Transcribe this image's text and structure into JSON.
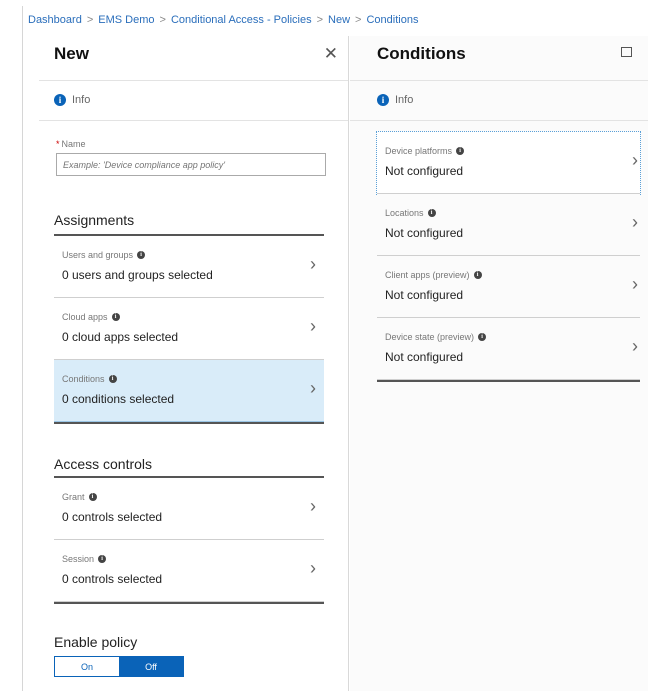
{
  "breadcrumb": [
    "Dashboard",
    "EMS Demo",
    "Conditional Access - Policies",
    "New",
    "Conditions"
  ],
  "left": {
    "title": "New",
    "info": "Info",
    "name_label": "Name",
    "name_placeholder": "Example: 'Device compliance app policy'",
    "assignments_title": "Assignments",
    "assignments": [
      {
        "label": "Users and groups",
        "value": "0 users and groups selected"
      },
      {
        "label": "Cloud apps",
        "value": "0 cloud apps selected"
      },
      {
        "label": "Conditions",
        "value": "0 conditions selected"
      }
    ],
    "access_title": "Access controls",
    "access": [
      {
        "label": "Grant",
        "value": "0 controls selected"
      },
      {
        "label": "Session",
        "value": "0 controls selected"
      }
    ],
    "enable_title": "Enable policy",
    "toggle_on": "On",
    "toggle_off": "Off"
  },
  "right": {
    "title": "Conditions",
    "info": "Info",
    "items": [
      {
        "label": "Device platforms",
        "value": "Not configured"
      },
      {
        "label": "Locations",
        "value": "Not configured"
      },
      {
        "label": "Client apps (preview)",
        "value": "Not configured"
      },
      {
        "label": "Device state (preview)",
        "value": "Not configured"
      }
    ]
  },
  "colors": {
    "accent": "#0a63b8",
    "selected_bg": "#d9ecf9"
  }
}
